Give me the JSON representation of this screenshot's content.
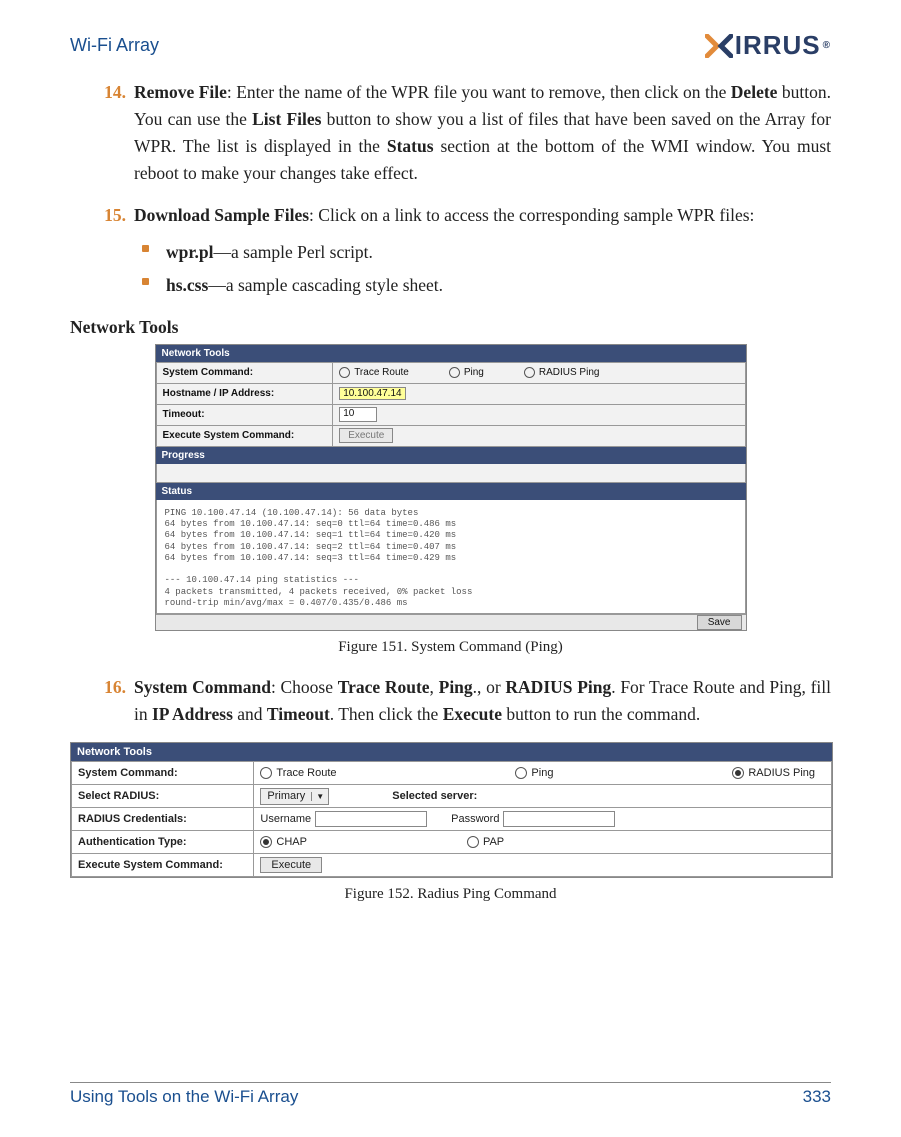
{
  "header": {
    "title": "Wi-Fi Array",
    "logo_text": "IRRUS"
  },
  "items": {
    "i14": {
      "num": "14.",
      "label": "Remove File",
      "rest": ": Enter the name of the WPR file you want to remove, then click on the ",
      "b1": "Delete",
      "rest2": " button. You can use the ",
      "b2": "List Files",
      "rest3": " button to show you a list of files that have been saved on the Array for WPR. The list is displayed in the ",
      "b3": "Status",
      "rest4": " section at the bottom of the WMI window. You must reboot to make your changes take effect."
    },
    "i15": {
      "num": "15.",
      "label": "Download Sample Files",
      "rest": ": Click on a link to access the corresponding sample WPR files:",
      "bullets": {
        "b1_bold": "wpr.pl",
        "b1_rest": "—a sample Perl script.",
        "b2_bold": "hs.css",
        "b2_rest": "—a sample cascading style sheet."
      }
    },
    "i16": {
      "num": "16.",
      "label": "System Command",
      "c1": ": Choose ",
      "b1": "Trace Route",
      "c2": ", ",
      "b2": "Ping",
      "c3": "., or ",
      "b3": "RADIUS Ping",
      "c4": ". For Trace Route and Ping, fill in ",
      "b4": "IP Address",
      "c5": " and ",
      "b5": "Timeout",
      "c6": ". Then click the ",
      "b6": "Execute",
      "c7": " button to run the command."
    }
  },
  "section_title": "Network Tools",
  "caption1": "Figure 151. System Command (Ping)",
  "caption2": "Figure 152. Radius Ping Command",
  "shot1": {
    "panel_title": "Network Tools",
    "row1_label": "System Command:",
    "opt_trace": "Trace Route",
    "opt_ping": "Ping",
    "opt_radius": "RADIUS Ping",
    "row2_label": "Hostname / IP Address:",
    "row2_value": "10.100.47.14",
    "row3_label": "Timeout:",
    "row3_value": "10",
    "row4_label": "Execute System Command:",
    "exec_label": "Execute",
    "progress_label": "Progress",
    "status_label": "Status",
    "status_text": "PING 10.100.47.14 (10.100.47.14): 56 data bytes\n64 bytes from 10.100.47.14: seq=0 ttl=64 time=0.486 ms\n64 bytes from 10.100.47.14: seq=1 ttl=64 time=0.420 ms\n64 bytes from 10.100.47.14: seq=2 ttl=64 time=0.407 ms\n64 bytes from 10.100.47.14: seq=3 ttl=64 time=0.429 ms\n\n--- 10.100.47.14 ping statistics ---\n4 packets transmitted, 4 packets received, 0% packet loss\nround-trip min/avg/max = 0.407/0.435/0.486 ms",
    "save_label": "Save"
  },
  "shot2": {
    "panel_title": "Network Tools",
    "row1_label": "System Command:",
    "opt_trace": "Trace Route",
    "opt_ping": "Ping",
    "opt_radius": "RADIUS Ping",
    "row2_label": "Select RADIUS:",
    "select_value": "Primary",
    "selected_server_label": "Selected server:",
    "row3_label": "RADIUS Credentials:",
    "username_label": "Username",
    "password_label": "Password",
    "row4_label": "Authentication Type:",
    "opt_chap": "CHAP",
    "opt_pap": "PAP",
    "row5_label": "Execute System Command:",
    "exec_label": "Execute"
  },
  "footer": {
    "left": "Using Tools on the Wi-Fi Array",
    "right": "333"
  }
}
